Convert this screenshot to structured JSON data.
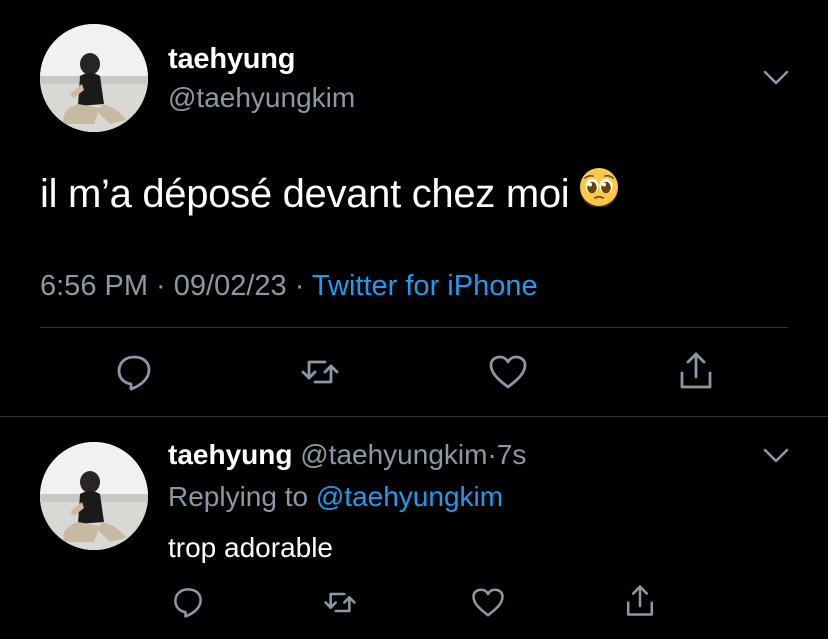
{
  "main_tweet": {
    "display_name": "taehyung",
    "handle": "@taehyungkim",
    "text": "il m’a déposé devant chez moi",
    "emoji": "pleading-face",
    "time": "6:56 PM",
    "sep1": " · ",
    "date": "09/02/23",
    "sep2": " · ",
    "source": "Twitter for iPhone"
  },
  "reply": {
    "display_name": "taehyung",
    "handle": "@taehyungkim",
    "dot": "·",
    "time": "7s",
    "replying_prefix": "Replying to ",
    "replying_to": "@taehyungkim",
    "text": "trop adorable"
  },
  "icons": {
    "reply": "reply-icon",
    "retweet": "retweet-icon",
    "like": "heart-icon",
    "share": "share-icon",
    "menu": "chevron-down-icon"
  },
  "colors": {
    "background": "#000000",
    "text_primary": "#ffffff",
    "text_secondary": "#8b98a5",
    "accent": "#1d9bf0",
    "divider": "#2f3336",
    "icon": "#8b98a5"
  }
}
